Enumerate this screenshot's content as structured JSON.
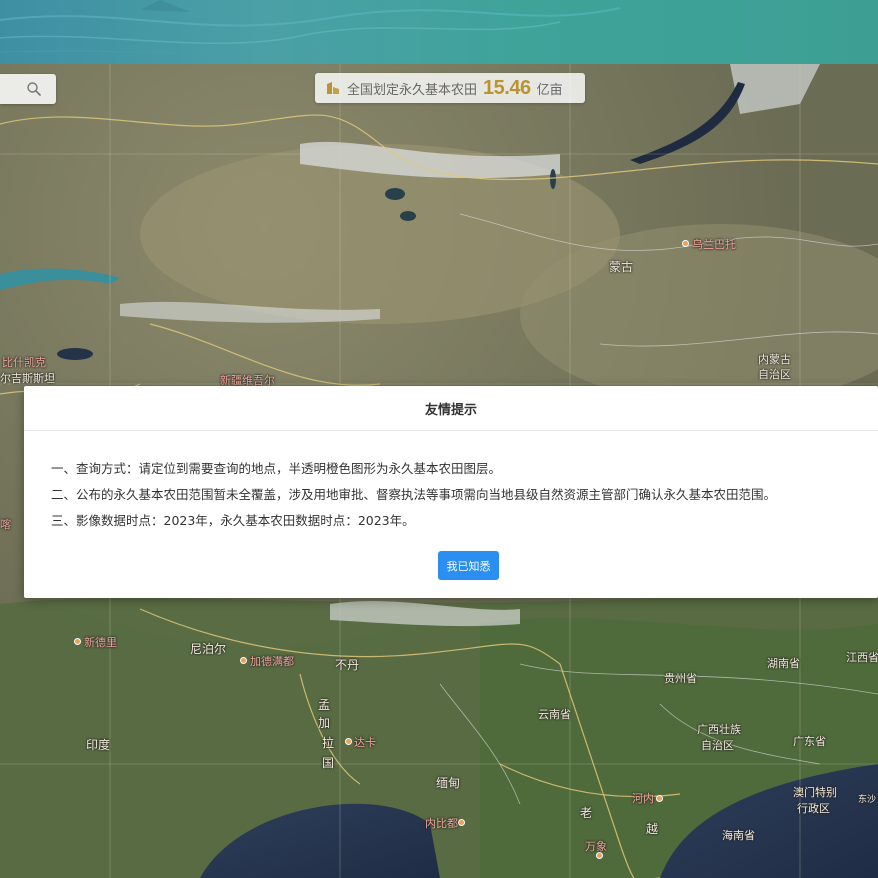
{
  "search": {
    "icon": "search-icon"
  },
  "stat": {
    "icon": "farmland-icon",
    "prefix": "全国划定永久基本农田",
    "value": "15.46",
    "unit": "亿亩",
    "value_color": "#b99432"
  },
  "map_labels": {
    "mongolia": "蒙古",
    "ulanbator": "乌兰巴托",
    "inner_mongolia_1": "内蒙古",
    "inner_mongolia_2": "自治区",
    "bishkek": "比什凯克",
    "kyrgyzstan": "尔吉斯斯坦",
    "xinjiang": "新疆维吾尔",
    "new_delhi": "新德里",
    "nepal": "尼泊尔",
    "kathmandu": "加德满都",
    "bhutan": "不丹",
    "bangladesh_1": "孟",
    "bangladesh_2": "加",
    "bangladesh_3": "拉",
    "bangladesh_4": "国",
    "dhaka": "达卡",
    "india": "印度",
    "yunnan": "云南省",
    "guizhou": "贵州省",
    "hunan": "湖南省",
    "jiangxi": "江西省",
    "guangxi_1": "广西壮族",
    "guangxi_2": "自治区",
    "guangdong": "广东省",
    "myanmar": "缅甸",
    "naypyidaw": "内比都",
    "laos": "老",
    "hanoi": "河内",
    "vietnam": "越",
    "vientiane": "万象",
    "macau_1": "澳门特别",
    "macau_2": "行政区",
    "hainan": "海南省",
    "dongsha": "东沙",
    "left_edge": "喀"
  },
  "modal": {
    "title": "友情提示",
    "line1": "一、查询方式：请定位到需要查询的地点，半透明橙色图形为永久基本农田图层。",
    "line2": "二、公布的永久基本农田范围暂未全覆盖，涉及用地审批、督察执法等事项需向当地县级自然资源主管部门确认永久基本农田范围。",
    "line3": "三、影像数据时点：2023年，永久基本农田数据时点：2023年。",
    "button_label": "我已知悉",
    "button_color": "#2a8ff1"
  }
}
